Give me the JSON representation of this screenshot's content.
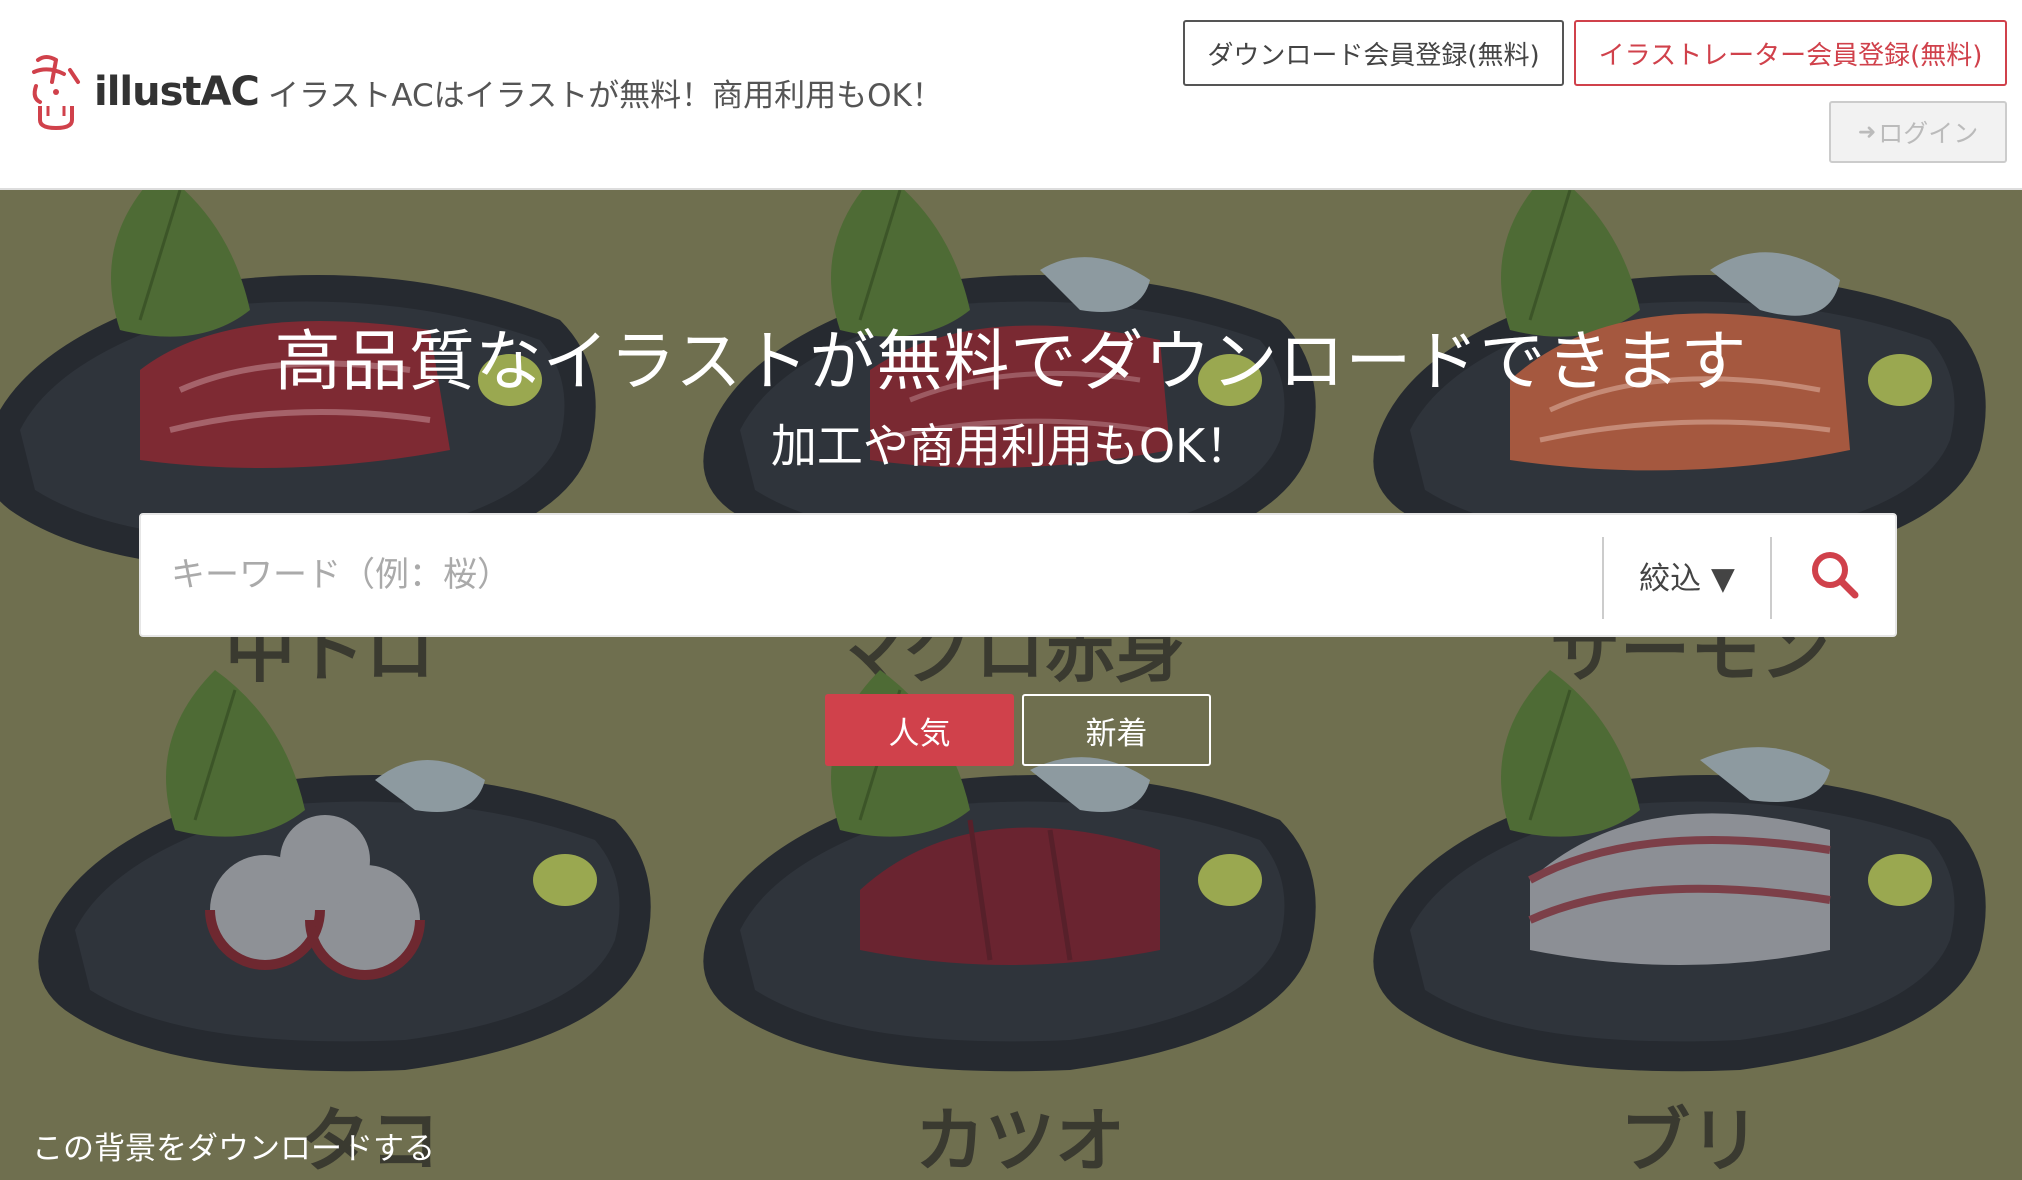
{
  "header": {
    "logo_text": "illustAC",
    "tagline": "イラストACはイラストが無料！商用利用もOK！",
    "download_member_label": "ダウンロード会員登録(無料)",
    "illustrator_member_label": "イラストレーター会員登録(無料)",
    "login_label": "ログイン"
  },
  "hero": {
    "headline": "高品質なイラストが無料でダウンロードできます",
    "subhead": "加工や商用利用もOK！",
    "background_labels": [
      "中トロ",
      "マグロ赤身",
      "サーモン",
      "タコ",
      "カツオ",
      "ブリ"
    ],
    "download_background_link": "この背景をダウンロードする"
  },
  "search": {
    "placeholder": "キーワード（例：桜）",
    "value": "",
    "filter_label": "絞込 ▼",
    "button_icon": "search-icon"
  },
  "tabs": [
    {
      "label": "人気",
      "active": true
    },
    {
      "label": "新着",
      "active": false
    }
  ],
  "colors": {
    "accent": "#d0414b",
    "hero_background": "#6f6f4f",
    "plate": "#2d3036"
  }
}
